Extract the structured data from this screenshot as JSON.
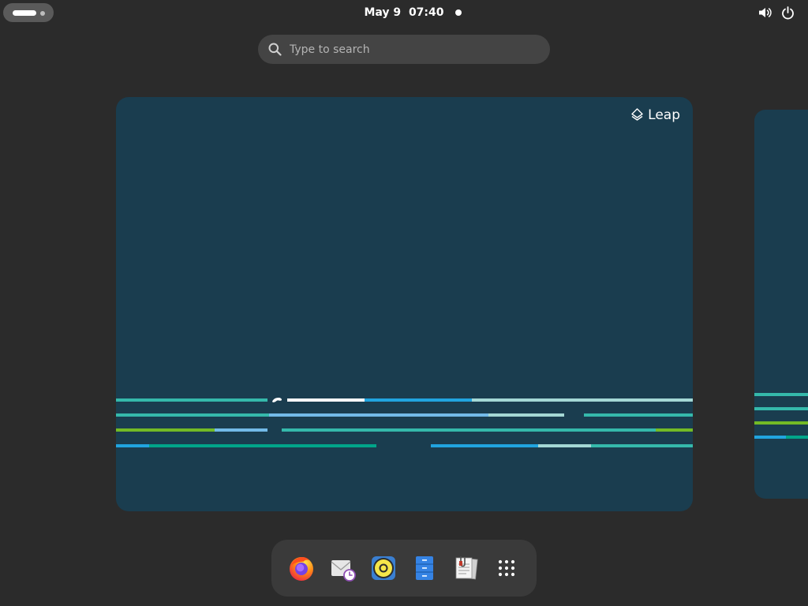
{
  "top_bar": {
    "date": "May 9",
    "time": "07:40",
    "activities_icon": "workspace-indicator-icon",
    "status_icons": [
      "volume-icon",
      "power-icon"
    ]
  },
  "search": {
    "placeholder": "Type to search",
    "icon": "search-icon"
  },
  "workspace": {
    "badge_label": "Leap",
    "badge_icon": "layers-icon",
    "wallpaper": "openSUSE Leap stripes"
  },
  "dash": {
    "apps": [
      {
        "name": "Firefox",
        "icon": "firefox-icon"
      },
      {
        "name": "Evolution",
        "icon": "mail-clock-icon"
      },
      {
        "name": "Rhythmbox",
        "icon": "speaker-icon"
      },
      {
        "name": "File Cabinet",
        "icon": "filing-cabinet-icon"
      },
      {
        "name": "Document Viewer",
        "icon": "documents-icon"
      },
      {
        "name": "Show Apps",
        "icon": "app-grid-icon"
      }
    ]
  },
  "colors": {
    "background": "#2b2b2b",
    "workspace": "#1a3d4f",
    "teal": "#35b9ab",
    "blue": "#21a4df",
    "light_blue": "#73bae8",
    "pale_teal": "#a4d8d5",
    "dark_teal": "#00a489",
    "green": "#73ba25"
  }
}
